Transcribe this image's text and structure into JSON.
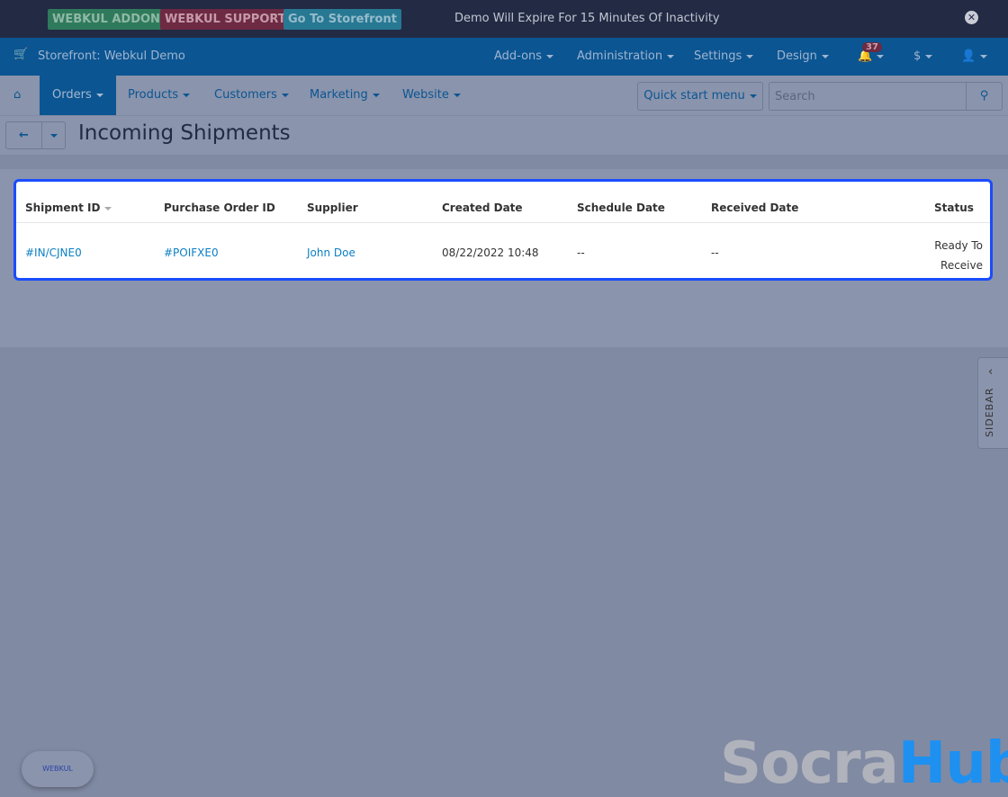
{
  "topbar": {
    "addon": "WEBKUL ADDON",
    "support": "WEBKUL SUPPORT",
    "storefront": "Go To Storefront",
    "notice": "Demo Will Expire For 15 Minutes Of Inactivity",
    "colors": {
      "addon": "#2f7a5c",
      "support": "#6d2a42",
      "storefront": "#277893"
    }
  },
  "header": {
    "store": "Storefront: Webkul Demo",
    "menus": [
      "Add-ons",
      "Administration",
      "Settings",
      "Design"
    ],
    "notifications": "37",
    "currency": "$"
  },
  "nav": {
    "items": [
      "Orders",
      "Products",
      "Customers",
      "Marketing",
      "Website"
    ],
    "quick_start": "Quick start menu",
    "search_placeholder": "Search"
  },
  "page": {
    "title": "Incoming Shipments"
  },
  "table": {
    "headers": [
      "Shipment ID",
      "Purchase Order ID",
      "Supplier",
      "Created Date",
      "Schedule Date",
      "Received Date",
      "Status"
    ],
    "rows": [
      {
        "shipment_id": "#IN/CJNE0",
        "po_id": "#POIFXE0",
        "supplier": "John Doe",
        "created": "08/22/2022 10:48",
        "scheduled": "--",
        "received": "--",
        "status_line1": "Ready To",
        "status_line2": "Receive"
      }
    ]
  },
  "sidebar": {
    "label": "SIDEBAR"
  },
  "footer": {
    "webkul": "WEBKUL",
    "brand_a": "Socra",
    "brand_b": "Hub"
  }
}
